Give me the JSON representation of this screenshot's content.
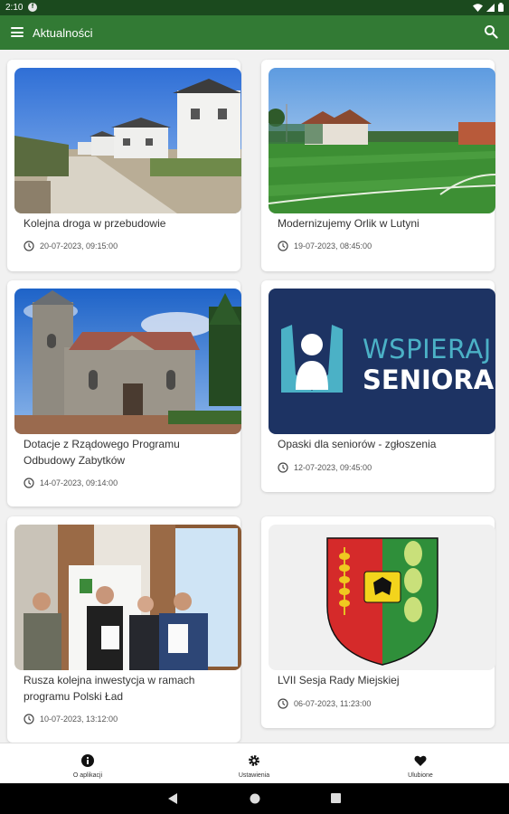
{
  "status_bar": {
    "time": "2:10",
    "app_icon": "f-icon",
    "icons": [
      "wifi-icon",
      "signal-icon",
      "battery-icon"
    ]
  },
  "app_bar": {
    "title": "Aktualności",
    "menu_icon": "menu-icon",
    "search_icon": "search-icon",
    "color": "#327a34"
  },
  "news": [
    {
      "title": "Kolejna droga w przebudowie",
      "date": "20-07-2023, 09:15:00",
      "image": "street-houses"
    },
    {
      "title": "Modernizujemy Orlik w Lutyni",
      "date": "19-07-2023, 08:45:00",
      "image": "football-pitch"
    },
    {
      "title": "Dotacje z Rządowego Programu Odbudowy Zabytków",
      "date": "14-07-2023, 09:14:00",
      "image": "church"
    },
    {
      "title": "Opaski dla seniorów - zgłoszenia",
      "date": "12-07-2023, 09:45:00",
      "image": "wspieraj-seniora-logo",
      "logo_text": [
        "WSPIERAJ",
        "SENIORA"
      ]
    },
    {
      "title": "Rusza kolejna inwestycja w ramach programu Polski Ład",
      "date": "10-07-2023, 13:12:00",
      "image": "signing-agreement"
    },
    {
      "title": "LVII Sesja Rady Miejskiej",
      "date": "06-07-2023, 11:23:00",
      "image": "coat-of-arms"
    }
  ],
  "bottom_nav": [
    {
      "label": "O aplikacji",
      "icon": "info-icon"
    },
    {
      "label": "Ustawienia",
      "icon": "gear-icon"
    },
    {
      "label": "Ulubione",
      "icon": "heart-icon"
    }
  ],
  "system_nav": [
    "back-icon",
    "home-icon",
    "recents-icon"
  ]
}
